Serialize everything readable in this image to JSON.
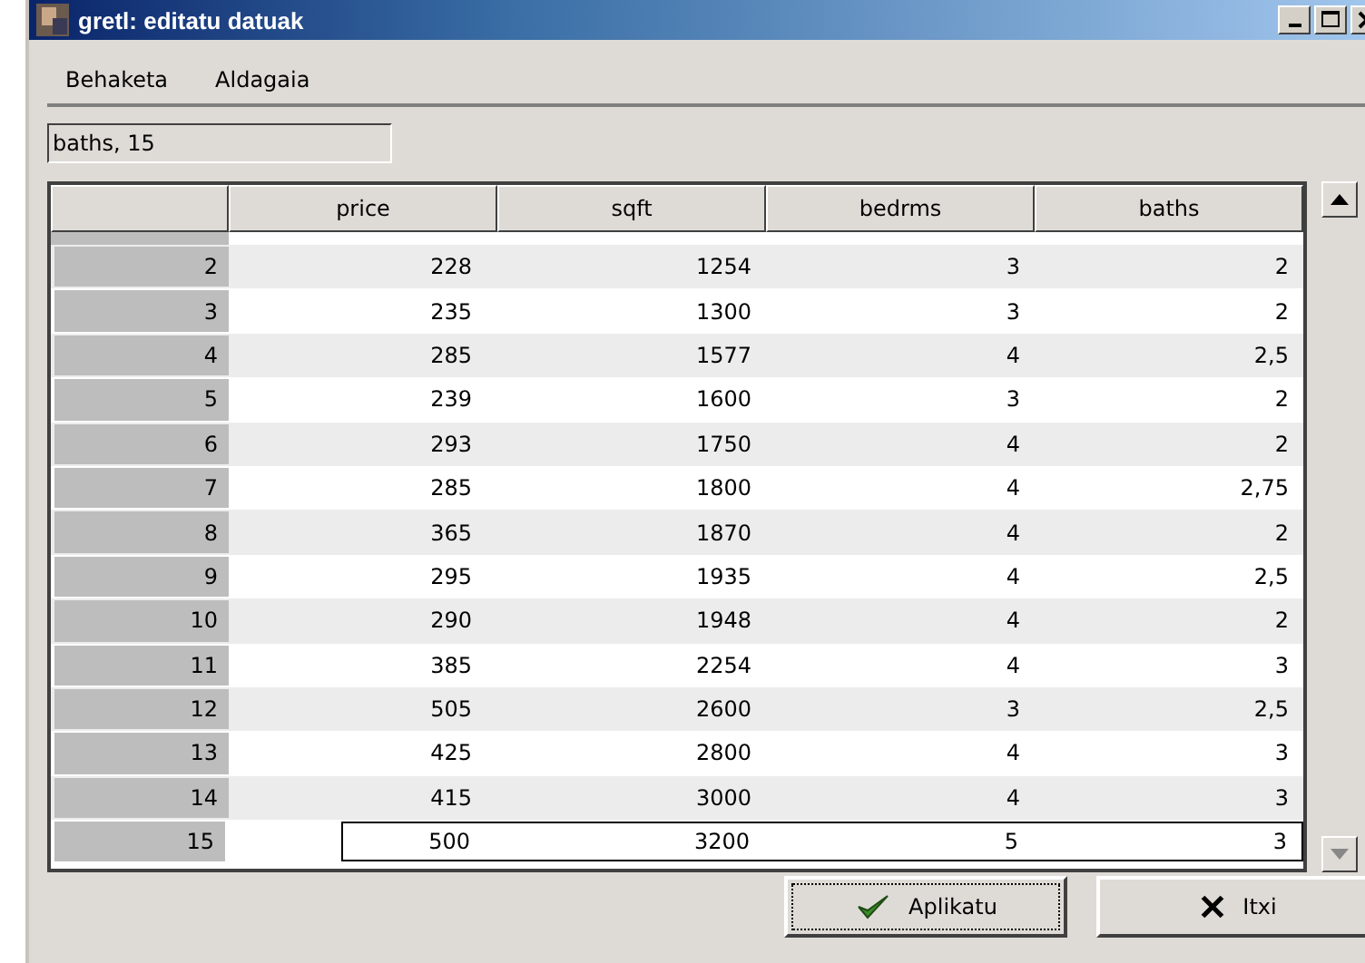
{
  "window": {
    "title": "gretl: editatu datuak"
  },
  "menu": [
    {
      "label": "Behaketa"
    },
    {
      "label": "Aldagaia"
    }
  ],
  "cell_field": {
    "value": "baths, 15"
  },
  "table": {
    "columns": [
      "price",
      "sqft",
      "bedrms",
      "baths"
    ],
    "rows": [
      {
        "index": "2",
        "cells": [
          "228",
          "1254",
          "3",
          "2"
        ],
        "selected": false
      },
      {
        "index": "3",
        "cells": [
          "235",
          "1300",
          "3",
          "2"
        ],
        "selected": false
      },
      {
        "index": "4",
        "cells": [
          "285",
          "1577",
          "4",
          "2,5"
        ],
        "selected": false
      },
      {
        "index": "5",
        "cells": [
          "239",
          "1600",
          "3",
          "2"
        ],
        "selected": false
      },
      {
        "index": "6",
        "cells": [
          "293",
          "1750",
          "4",
          "2"
        ],
        "selected": false
      },
      {
        "index": "7",
        "cells": [
          "285",
          "1800",
          "4",
          "2,75"
        ],
        "selected": false
      },
      {
        "index": "8",
        "cells": [
          "365",
          "1870",
          "4",
          "2"
        ],
        "selected": false
      },
      {
        "index": "9",
        "cells": [
          "295",
          "1935",
          "4",
          "2,5"
        ],
        "selected": false
      },
      {
        "index": "10",
        "cells": [
          "290",
          "1948",
          "4",
          "2"
        ],
        "selected": false
      },
      {
        "index": "11",
        "cells": [
          "385",
          "2254",
          "4",
          "3"
        ],
        "selected": false
      },
      {
        "index": "12",
        "cells": [
          "505",
          "2600",
          "3",
          "2,5"
        ],
        "selected": false
      },
      {
        "index": "13",
        "cells": [
          "425",
          "2800",
          "4",
          "3"
        ],
        "selected": false
      },
      {
        "index": "14",
        "cells": [
          "415",
          "3000",
          "4",
          "3"
        ],
        "selected": false
      },
      {
        "index": "15",
        "cells": [
          "500",
          "3200",
          "5",
          "3"
        ],
        "selected": true
      }
    ]
  },
  "buttons": [
    {
      "label": "Aplikatu",
      "kind": "apply"
    },
    {
      "label": "Itxi",
      "kind": "close"
    }
  ]
}
